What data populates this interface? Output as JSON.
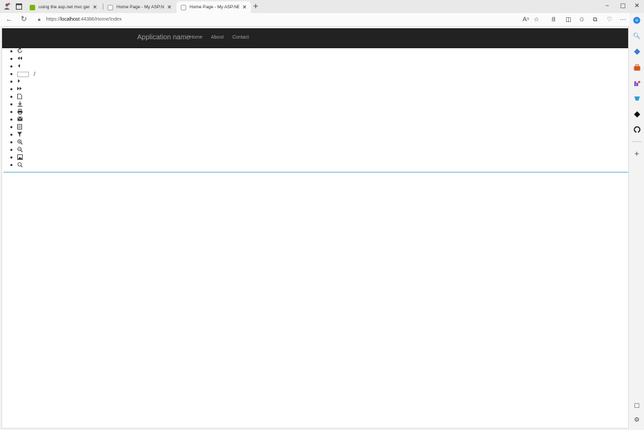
{
  "browser": {
    "tabs": [
      {
        "label": "using the asp.net mvc generic la",
        "close": "✕",
        "active": false,
        "favicon_color": "#7cb305"
      },
      {
        "label": "Home Page - My ASP.NET Applic",
        "close": "✕",
        "active": false,
        "favicon_color": "#c8c8c8"
      },
      {
        "label": "Home Page - My ASP.NET Applic",
        "close": "✕",
        "active": true,
        "favicon_color": "#c8c8c8"
      }
    ],
    "new_tab": "+",
    "window_controls": {
      "minimize": "−",
      "restore": "▢",
      "close": "✕"
    },
    "address": {
      "prefix": "https://",
      "host": "localhost",
      "rest": ":44386/Home/Index"
    },
    "toolbar": {
      "read_aloud": "A⁵",
      "favorite": "☆",
      "more": "···"
    }
  },
  "site": {
    "brand": "Application name",
    "nav": [
      "Home",
      "About",
      "Contact"
    ],
    "report_toolbar": {
      "page_separator": "/",
      "icons": [
        "refresh-icon",
        "first-page-icon",
        "previous-page-icon",
        "page-number",
        "next-page-icon",
        "last-page-icon",
        "document-icon",
        "download-icon",
        "print-icon",
        "email-icon",
        "page-setup-icon",
        "filter-icon",
        "zoom-in-icon",
        "zoom-out-icon",
        "image-icon",
        "search-icon"
      ]
    }
  },
  "colors": {
    "navbar_bg": "#222222",
    "navbar_text": "#9d9d9d",
    "accent_rule": "#a6d1ea"
  }
}
